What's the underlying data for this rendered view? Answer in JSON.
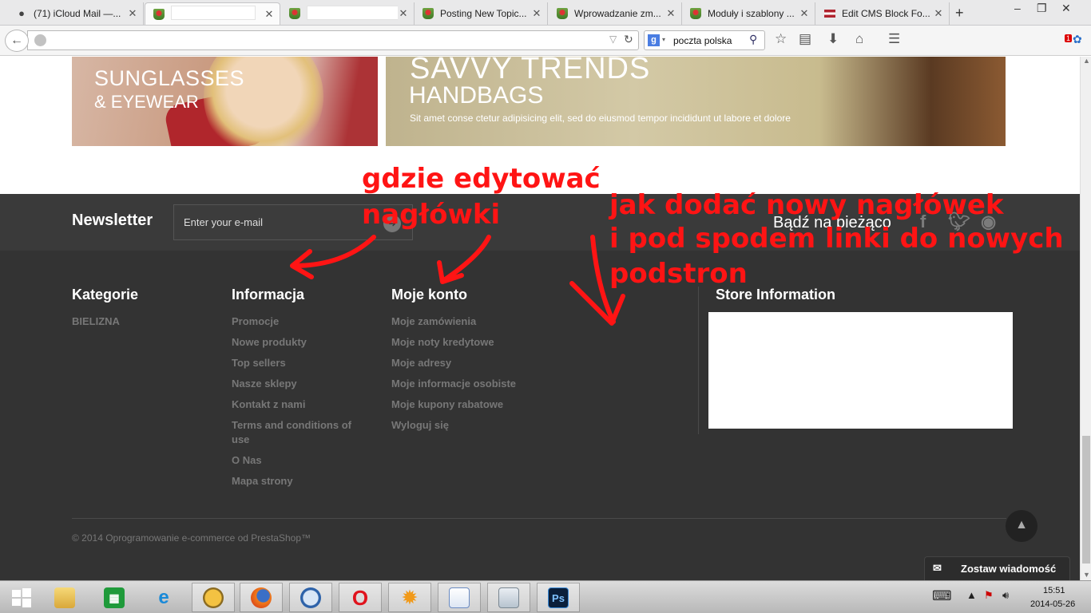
{
  "browser": {
    "tabs": [
      {
        "label": "(71) iCloud Mail —...",
        "icon": "apple-icon"
      },
      {
        "label": "",
        "icon": "prestashop-icon"
      },
      {
        "label": "",
        "icon": "prestashop-icon"
      },
      {
        "label": "Posting New Topic...",
        "icon": "prestashop-icon"
      },
      {
        "label": "Wprowadzanie zm...",
        "icon": "prestashop-icon"
      },
      {
        "label": "Moduły i szablony ...",
        "icon": "prestashop-icon"
      },
      {
        "label": "Edit CMS Block Fo...",
        "icon": "latvia-flag-icon"
      }
    ],
    "new_tab": "+",
    "window_controls": {
      "minimize": "–",
      "restore": "❐",
      "close": "✕"
    },
    "url": "",
    "search": {
      "engine": "g",
      "value": "poczta polska"
    },
    "notification_count": "1"
  },
  "banners": {
    "left": {
      "title": "SUNGLASSES",
      "subtitle": "& EYEWEAR"
    },
    "right": {
      "title": "SAVVY TRENDS",
      "subtitle": "HANDBAGS",
      "text": "Sit amet conse ctetur adipisicing elit, sed do eiusmod tempor incididunt ut labore et dolore"
    }
  },
  "newsletter": {
    "title": "Newsletter",
    "placeholder": "Enter your e-mail",
    "follow": "Bądź na bieżąco"
  },
  "footer": {
    "columns": [
      {
        "title": "Kategorie",
        "links": [
          "BIELIZNA"
        ]
      },
      {
        "title": "Informacja",
        "links": [
          "Promocje",
          "Nowe produkty",
          "Top sellers",
          "Nasze sklepy",
          "Kontakt z nami",
          "Terms and conditions of use",
          "O Nas",
          "Mapa strony"
        ]
      },
      {
        "title": "Moje konto",
        "links": [
          "Moje zamówienia",
          "Moje noty kredytowe",
          "Moje adresy",
          "Moje informacje osobiste",
          "Moje kupony rabatowe",
          "Wyloguj się"
        ]
      }
    ],
    "store_title": "Store Information",
    "copyright": "© 2014 Oprogramowanie e-commerce od PrestaShop™"
  },
  "chat": {
    "label": "Zostaw wiadomość"
  },
  "annotations": {
    "left": [
      "gdzie edytować",
      "nagłówki"
    ],
    "right": [
      "jak dodać nowy nagłówek",
      "i pod spodem linki do nowych",
      "podstron"
    ]
  },
  "taskbar": {
    "apps": [
      "start-icon",
      "file-explorer-icon",
      "store-icon",
      "internet-explorer-icon",
      "mail-app-icon",
      "firefox-icon",
      "gt-app-icon",
      "opera-icon",
      "sun-app-icon",
      "wordpad-icon",
      "calculator-icon",
      "photoshop-icon"
    ],
    "photoshop_label": "Ps",
    "time": "15:51",
    "date": "2014-05-26"
  },
  "colors": {
    "annotation": "#ff1414",
    "footer_bg": "#333333",
    "newsletter_bg": "#3a3a3a",
    "link": "#777777"
  }
}
